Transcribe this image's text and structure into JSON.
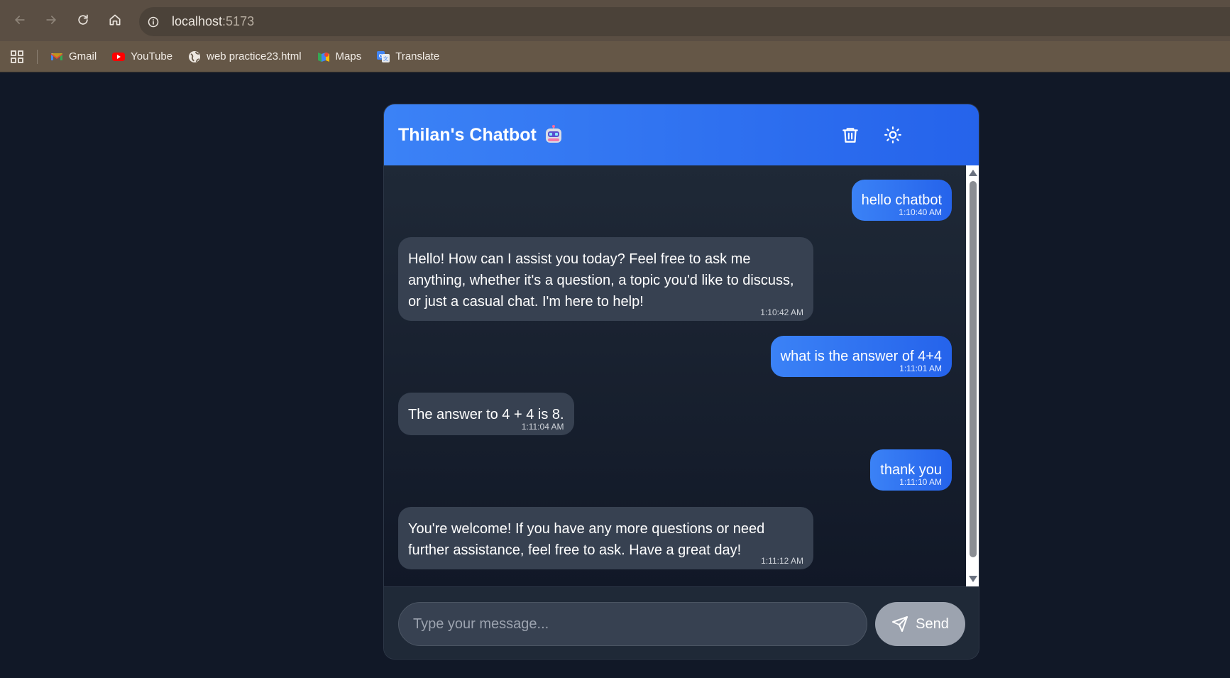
{
  "browser": {
    "url_host": "localhost",
    "url_port": ":5173",
    "bookmarks": [
      {
        "label": "Gmail",
        "icon": "gmail-icon"
      },
      {
        "label": "YouTube",
        "icon": "youtube-icon"
      },
      {
        "label": "web practice23.html",
        "icon": "globe-icon"
      },
      {
        "label": "Maps",
        "icon": "maps-icon"
      },
      {
        "label": "Translate",
        "icon": "translate-icon"
      }
    ]
  },
  "chat": {
    "title": "Thilan's Chatbot",
    "title_icon": "robot-icon",
    "actions": {
      "clear_icon": "trash-icon",
      "theme_icon": "sun-icon"
    },
    "messages": [
      {
        "role": "user",
        "text": "hello chatbot",
        "time": "1:10:40 AM"
      },
      {
        "role": "bot",
        "text": "Hello! How can I assist you today? Feel free to ask me anything, whether it's a question, a topic you'd like to discuss, or just a casual chat. I'm here to help!",
        "time": "1:10:42 AM"
      },
      {
        "role": "user",
        "text": "what is the answer of 4+4",
        "time": "1:11:01 AM"
      },
      {
        "role": "bot",
        "text": "The answer to 4 + 4 is 8.",
        "time": "1:11:04 AM"
      },
      {
        "role": "user",
        "text": "thank you",
        "time": "1:11:10 AM"
      },
      {
        "role": "bot",
        "text": "You're welcome! If you have any more questions or need further assistance, feel free to ask. Have a great day!",
        "time": "1:11:12 AM"
      }
    ],
    "input": {
      "placeholder": "Type your message...",
      "value": ""
    },
    "send_label": "Send",
    "colors": {
      "accent": "#3b82f6",
      "accent_dark": "#2563eb",
      "bot_bubble": "#374151",
      "background": "#111827",
      "send_disabled": "#9ca3af"
    }
  }
}
